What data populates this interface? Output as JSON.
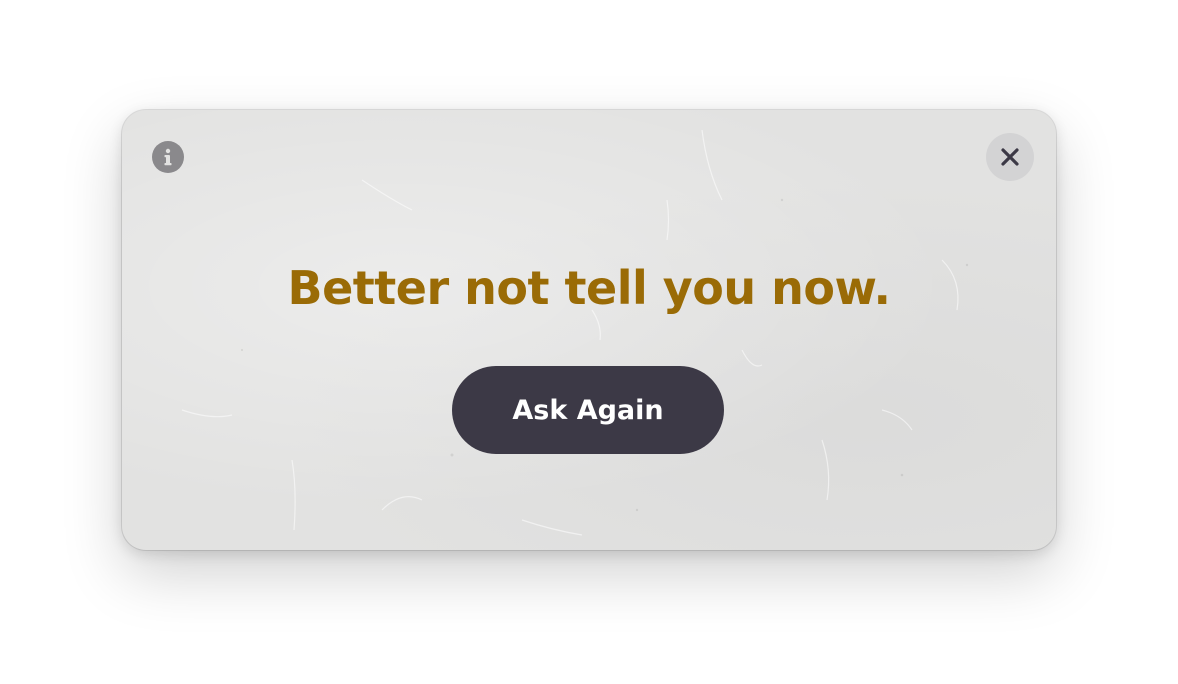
{
  "window": {
    "background_color": "#e2e2e1"
  },
  "header": {
    "info_icon": "info-icon",
    "close_icon": "close-icon"
  },
  "main": {
    "answer_text": "Better not tell you now.",
    "answer_color": "#9a6b06",
    "ask_again_label": "Ask Again",
    "ask_again_color": "#3c3946"
  }
}
